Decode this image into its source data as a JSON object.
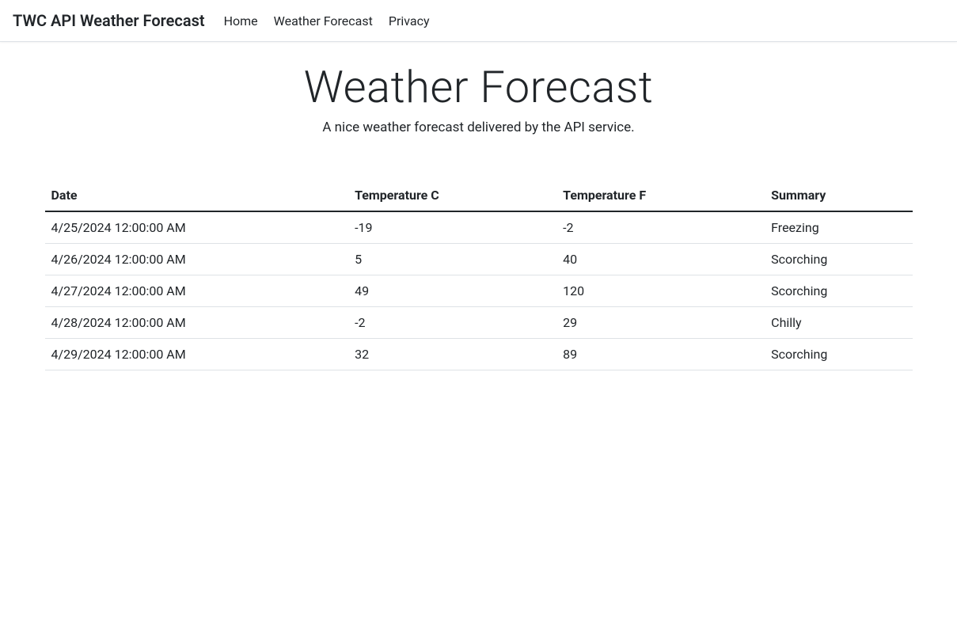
{
  "nav": {
    "brand": "TWC API Weather Forecast",
    "links": [
      {
        "label": "Home"
      },
      {
        "label": "Weather Forecast"
      },
      {
        "label": "Privacy"
      }
    ]
  },
  "page": {
    "title": "Weather Forecast",
    "subtitle": "A nice weather forecast delivered by the API service."
  },
  "table": {
    "headers": {
      "date": "Date",
      "tempC": "Temperature C",
      "tempF": "Temperature F",
      "summary": "Summary"
    },
    "rows": [
      {
        "date": "4/25/2024 12:00:00 AM",
        "tempC": "-19",
        "tempF": "-2",
        "summary": "Freezing"
      },
      {
        "date": "4/26/2024 12:00:00 AM",
        "tempC": "5",
        "tempF": "40",
        "summary": "Scorching"
      },
      {
        "date": "4/27/2024 12:00:00 AM",
        "tempC": "49",
        "tempF": "120",
        "summary": "Scorching"
      },
      {
        "date": "4/28/2024 12:00:00 AM",
        "tempC": "-2",
        "tempF": "29",
        "summary": "Chilly"
      },
      {
        "date": "4/29/2024 12:00:00 AM",
        "tempC": "32",
        "tempF": "89",
        "summary": "Scorching"
      }
    ]
  }
}
